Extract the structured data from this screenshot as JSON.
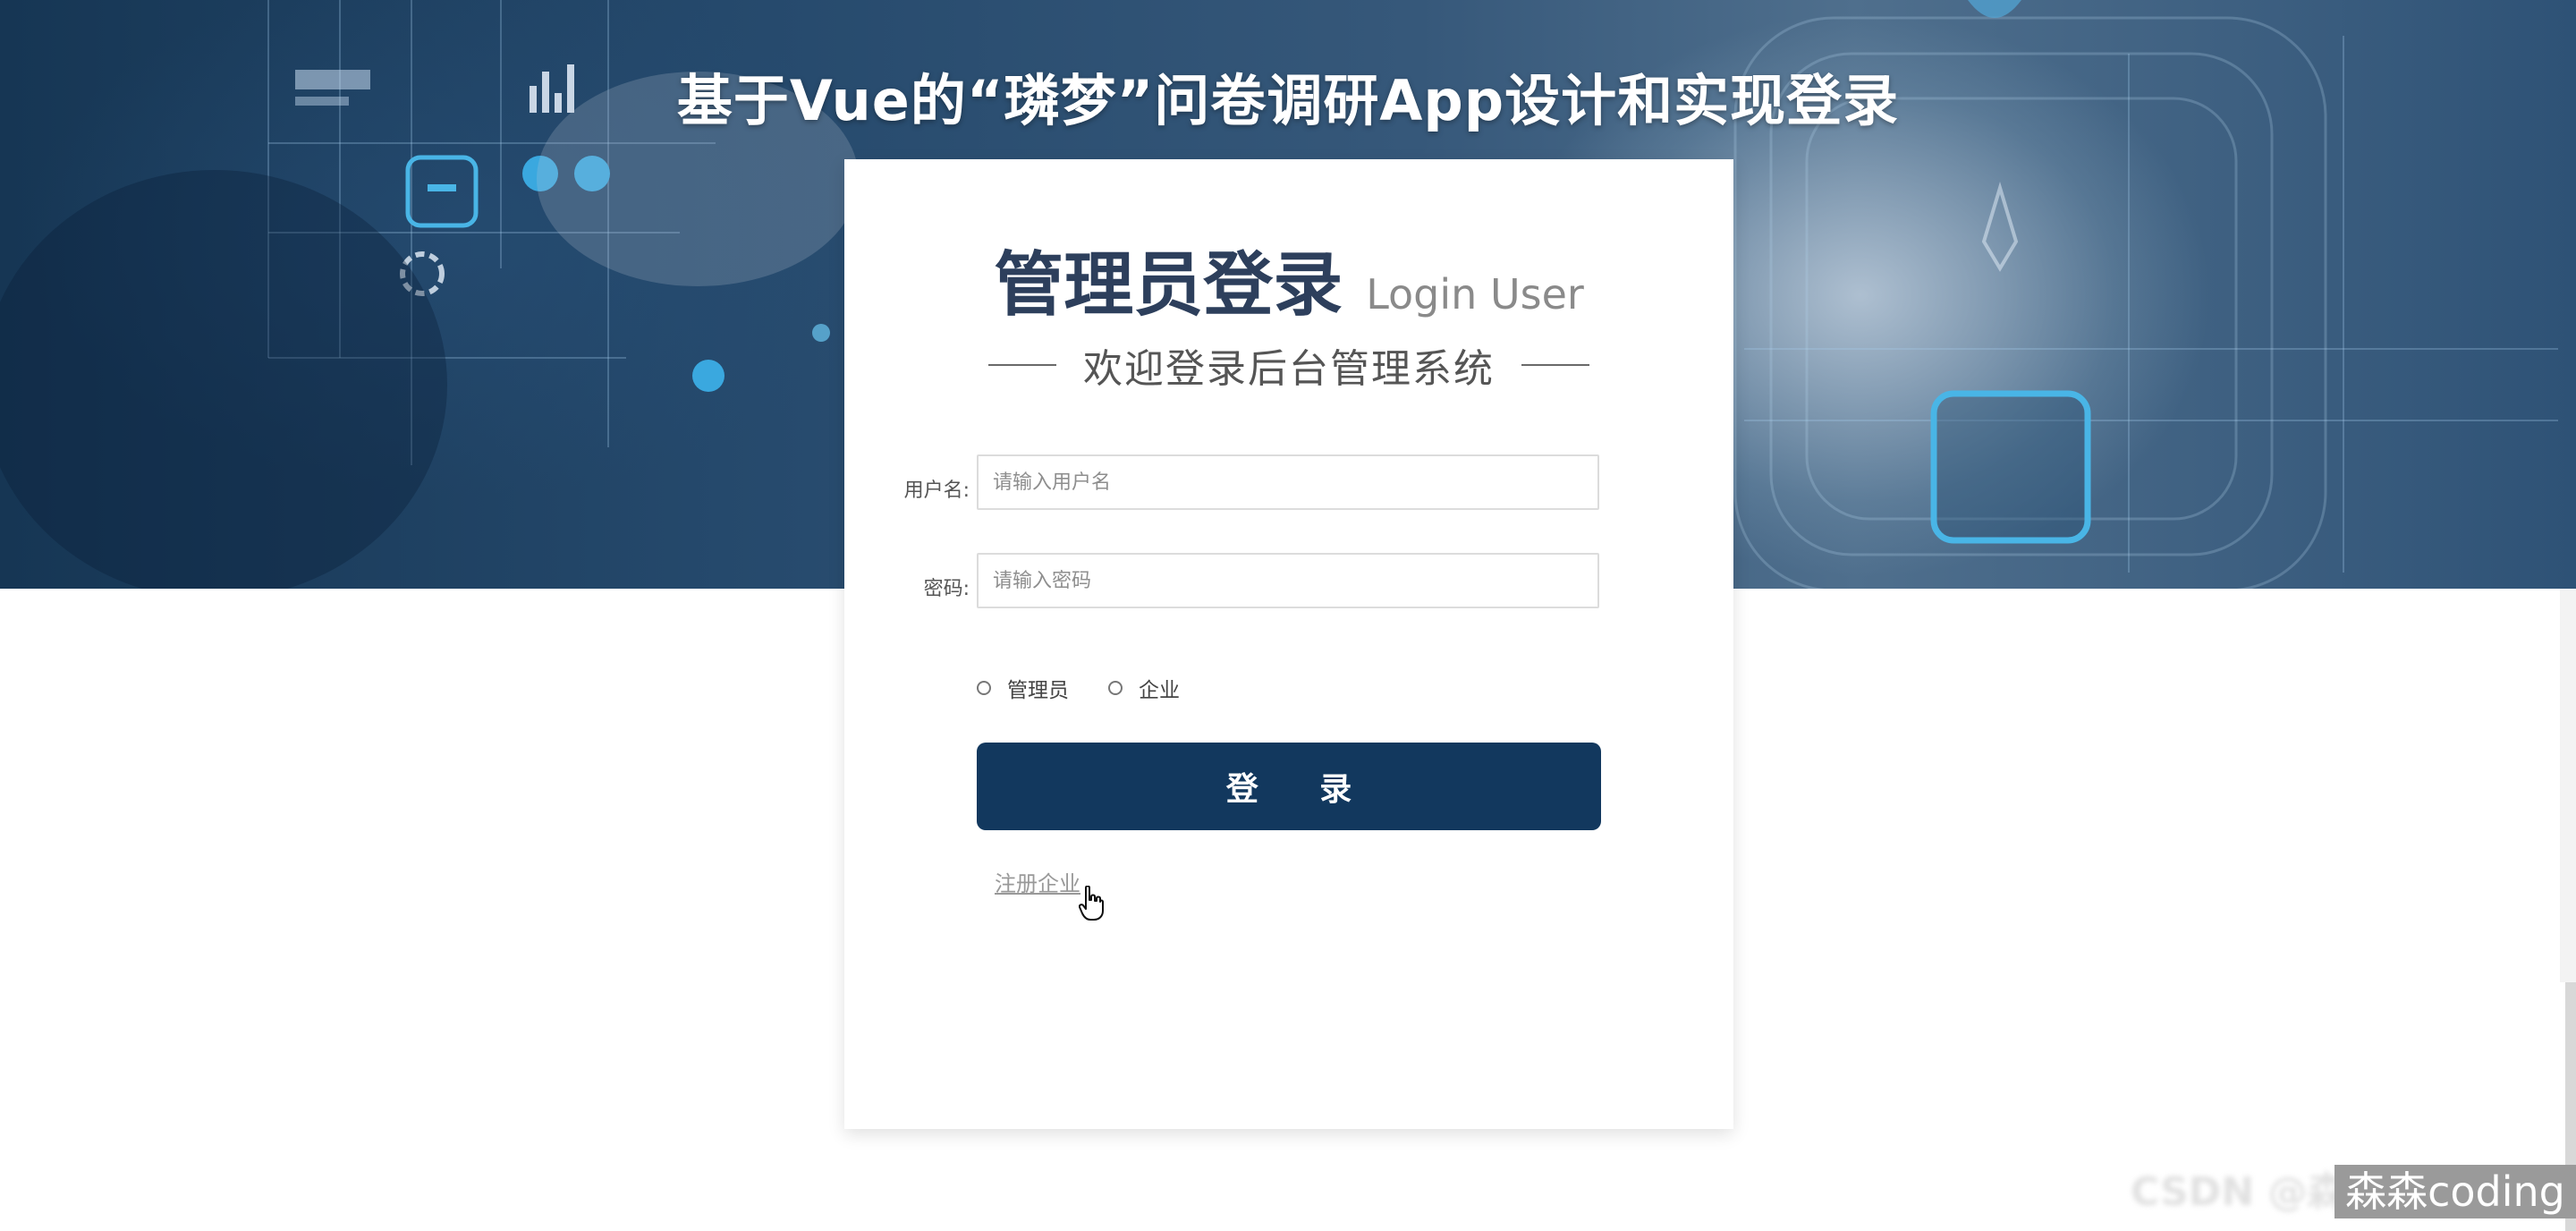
{
  "page": {
    "title": "基于Vue的“璘梦”问卷调研App设计和实现登录"
  },
  "card": {
    "title": "管理员登录",
    "subtitle": "Login User",
    "welcome": "欢迎登录后台管理系统"
  },
  "form": {
    "username_label": "用户名:",
    "username_placeholder": "请输入用户名",
    "username_value": "",
    "password_label": "密码:",
    "password_placeholder": "请输入密码",
    "password_value": "",
    "roles": [
      "管理员",
      "企业"
    ],
    "login_label": "登 录",
    "register_label": "注册企业"
  },
  "watermark": {
    "blurred": "CSDN @森森",
    "text": "森森coding"
  },
  "colors": {
    "primary": "#12385e",
    "title": "#2d3f5c"
  },
  "icons": [
    "pointer-hand-icon",
    "radio-icon"
  ]
}
